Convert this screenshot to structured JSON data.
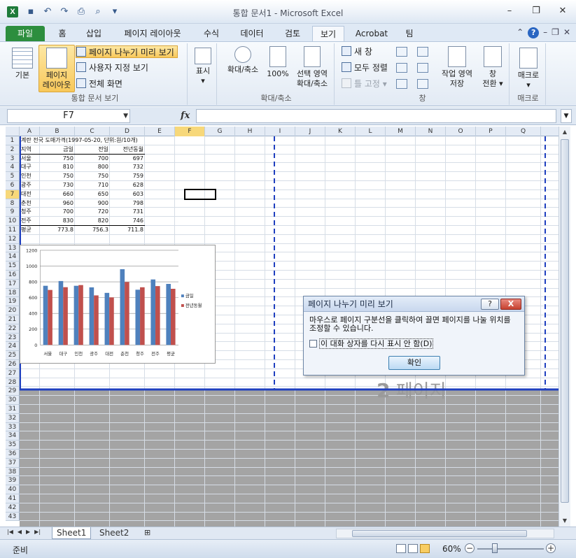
{
  "window": {
    "title": "통합 문서1 - Microsoft Excel",
    "app_icon": "X",
    "qat_icons": [
      "save-icon",
      "undo-icon",
      "redo-icon",
      "print-icon",
      "print-preview-icon",
      "qat-customize-icon"
    ]
  },
  "ribbon_tabs": [
    "파일",
    "홈",
    "삽입",
    "페이지 레이아웃",
    "수식",
    "데이터",
    "검토",
    "보기",
    "Acrobat",
    "팀"
  ],
  "active_tab": "보기",
  "ribbon": {
    "group_workbook_views": {
      "label": "통합 문서 보기",
      "normal": "기본",
      "page_layout_line1": "페이지",
      "page_layout_line2": "레이아웃",
      "page_break_preview": "페이지 나누기 미리 보기",
      "custom_views": "사용자 지정 보기",
      "full_screen": "전체 화면"
    },
    "group_show": {
      "label": "표시"
    },
    "group_zoom": {
      "label": "확대/축소",
      "zoom": "확대/축소",
      "zoom_100": "100%",
      "zoom_selection_line1": "선택 영역",
      "zoom_selection_line2": "확대/축소"
    },
    "group_window": {
      "label": "창",
      "new_window": "새 창",
      "arrange_all": "모두 정렬",
      "freeze_panes": "틀 고정",
      "save_workspace_line1": "작업 영역",
      "save_workspace_line2": "저장",
      "switch_windows_line1": "창",
      "switch_windows_line2": "전환"
    },
    "group_macros": {
      "label": "매크로",
      "macros": "매크로"
    }
  },
  "formula_bar": {
    "name_box": "F7",
    "fx": "fx",
    "content": ""
  },
  "columns": [
    "A",
    "B",
    "C",
    "D",
    "E",
    "F",
    "G",
    "H",
    "I",
    "J",
    "K",
    "L",
    "M",
    "N",
    "O",
    "P",
    "Q"
  ],
  "rows": [
    "1",
    "2",
    "3",
    "4",
    "5",
    "6",
    "7",
    "8",
    "9",
    "10",
    "11",
    "12",
    "13",
    "14",
    "15",
    "16",
    "17",
    "18",
    "19",
    "20",
    "21",
    "22",
    "23",
    "24",
    "25",
    "26",
    "27",
    "28",
    "29",
    "30",
    "31",
    "32",
    "33",
    "34",
    "35",
    "36",
    "37",
    "38",
    "39",
    "40",
    "41",
    "42",
    "43"
  ],
  "active_cell": "F7",
  "sheet": {
    "title": "계란 전국 도매가격(1997-05-20, 단위:원/10개)",
    "headers": [
      "지역",
      "금일",
      "전일",
      "전년동월"
    ],
    "rows": [
      [
        "서울",
        "750",
        "700",
        "697"
      ],
      [
        "대구",
        "810",
        "800",
        "732"
      ],
      [
        "인천",
        "750",
        "750",
        "759"
      ],
      [
        "광주",
        "730",
        "710",
        "628"
      ],
      [
        "대전",
        "660",
        "650",
        "603"
      ],
      [
        "춘천",
        "960",
        "900",
        "798"
      ],
      [
        "청주",
        "700",
        "720",
        "731"
      ],
      [
        "전주",
        "830",
        "820",
        "746"
      ]
    ],
    "average": [
      "평균",
      "773.8",
      "756.3",
      "711.8"
    ]
  },
  "page_label": {
    "num": "2",
    "text": "페이지"
  },
  "chart_data": {
    "type": "bar",
    "categories": [
      "서울",
      "대구",
      "인천",
      "광주",
      "대전",
      "춘천",
      "청주",
      "전주",
      "평균"
    ],
    "series": [
      {
        "name": "금일",
        "values": [
          750,
          810,
          750,
          730,
          660,
          960,
          700,
          830,
          773.8
        ],
        "color": "#4f81bd"
      },
      {
        "name": "전년동월",
        "values": [
          697,
          732,
          759,
          628,
          603,
          798,
          731,
          746,
          711.8
        ],
        "color": "#c0504d"
      }
    ],
    "ylim": [
      0,
      1200
    ],
    "yticks": [
      0,
      200,
      400,
      600,
      800,
      1000,
      1200
    ],
    "grid": true,
    "legend": "right"
  },
  "dialog": {
    "title": "페이지 나누기 미리 보기",
    "help": "?",
    "close": "X",
    "message": "마우스로 페이지 구분선을 클릭하여 끌면 페이지를 나눌 위치를 조정할 수 있습니다.",
    "checkbox": "이 대화 상자를 다시 표시 안 함(D)",
    "ok": "확인"
  },
  "sheet_tabs": [
    "Sheet1",
    "Sheet2"
  ],
  "active_sheet": "Sheet1",
  "status": {
    "ready": "준비",
    "zoom": "60%"
  },
  "colors": {
    "file_tab": "#2d8e3e",
    "page_break_line": "#1f3fbf",
    "selected_button": "#f8c85a"
  }
}
